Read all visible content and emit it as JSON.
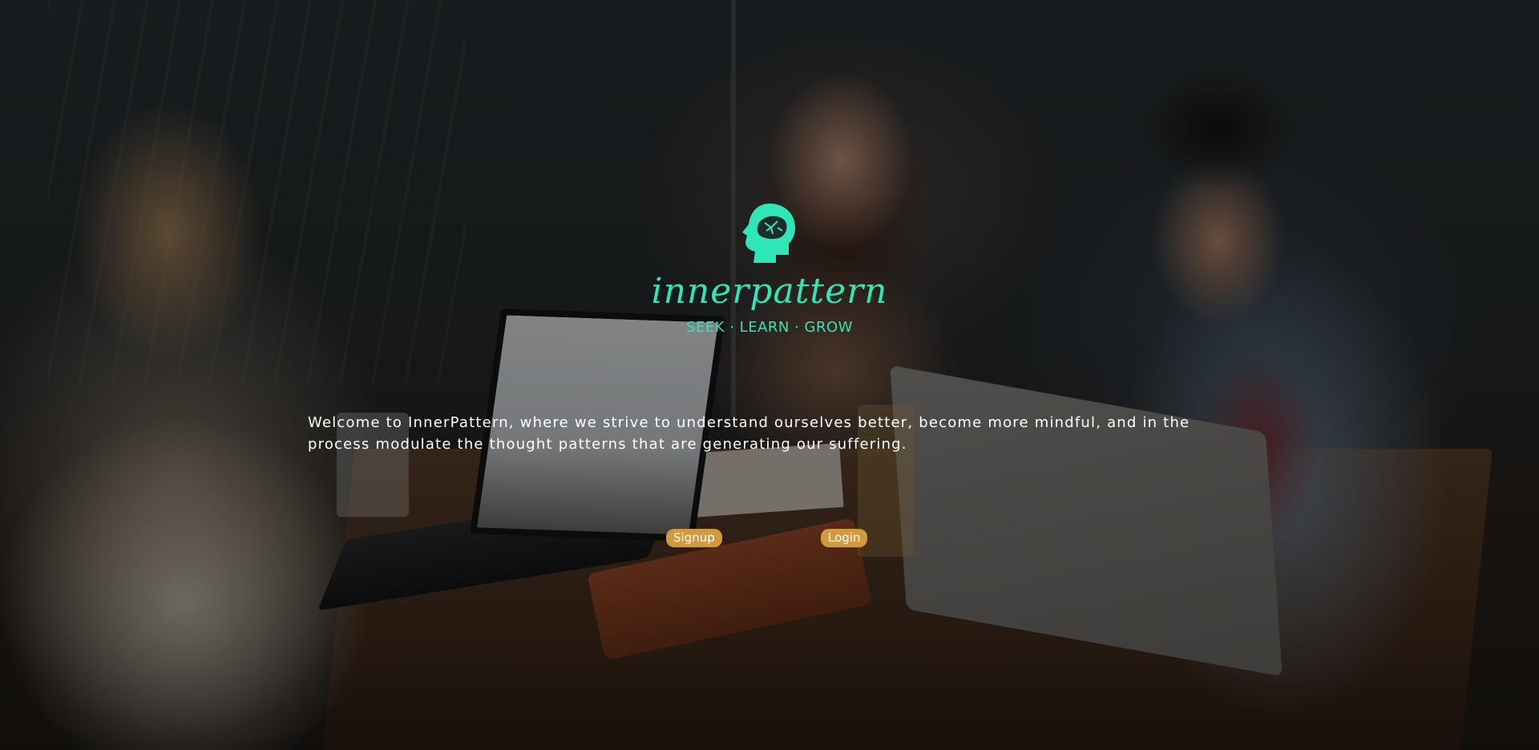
{
  "brand": {
    "logo_icon": "brain-head-icon",
    "name": "innerpattern",
    "tagline": "SEEK · LEARN · GROW"
  },
  "hero": {
    "welcome_text": "Welcome to InnerPattern, where we strive to understand ourselves better, become more mindful, and in the process modulate the thought patterns that are generating our suffering."
  },
  "actions": {
    "signup_label": "Signup",
    "login_label": "Login"
  },
  "colors": {
    "accent": "#2ee6b6",
    "button": "#d29a3e",
    "text": "#ffffff"
  }
}
